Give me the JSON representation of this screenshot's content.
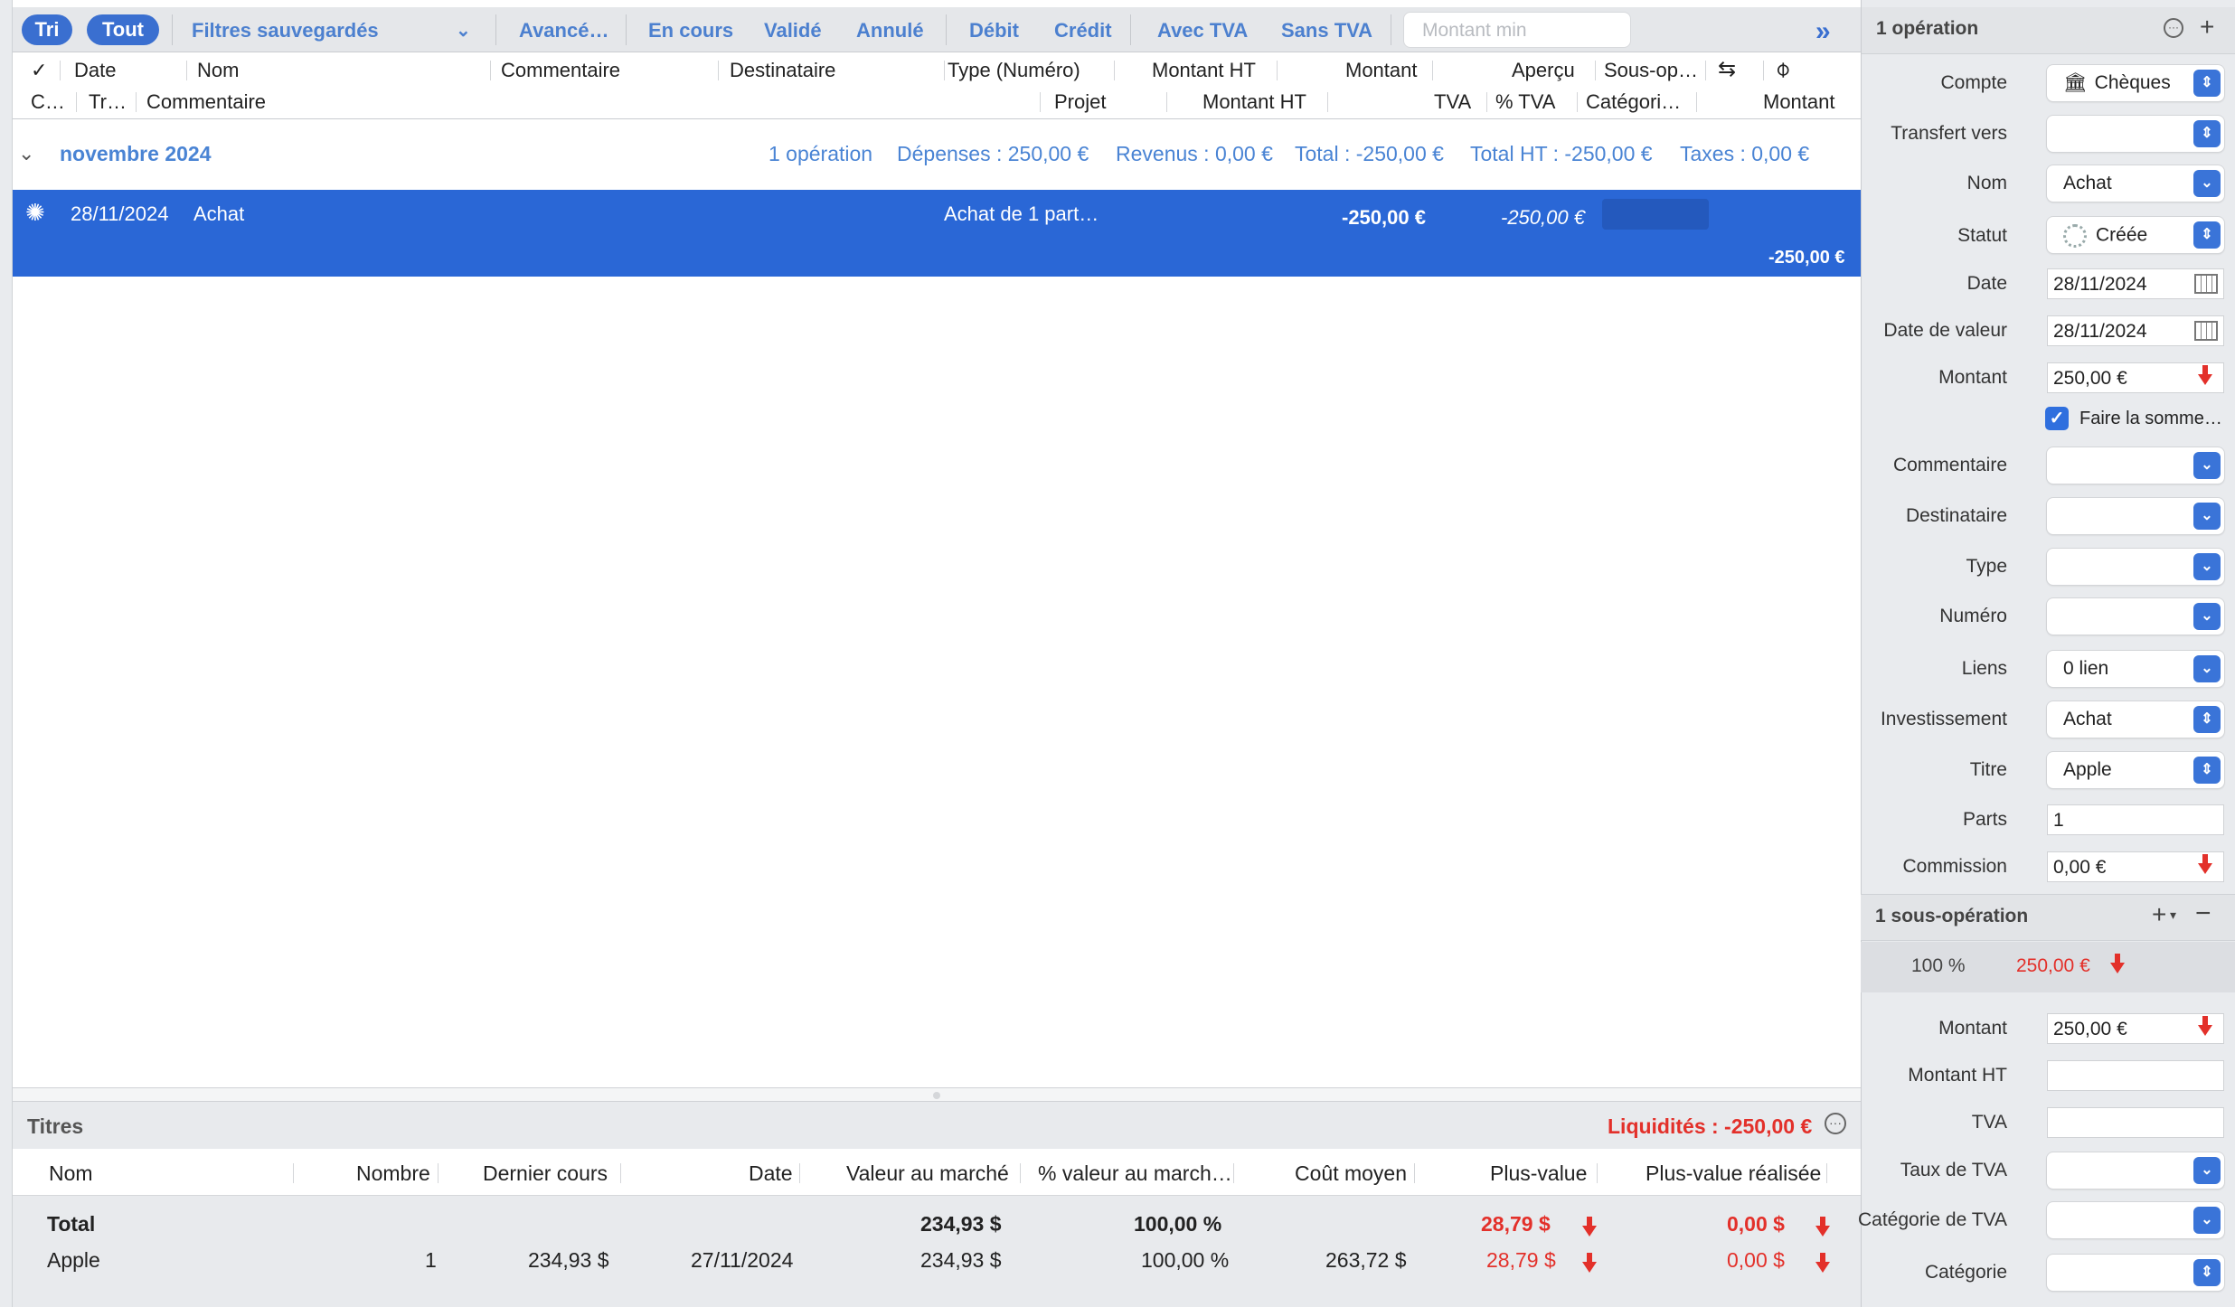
{
  "filters": {
    "sort_label": "Tri",
    "all_label": "Tout",
    "saved_filters": "Filtres sauvegardés",
    "advanced": "Avancé…",
    "in_progress": "En cours",
    "validated": "Validé",
    "cancelled": "Annulé",
    "debit": "Débit",
    "credit": "Crédit",
    "with_vat": "Avec TVA",
    "without_vat": "Sans TVA",
    "min_amount_placeholder": "Montant min"
  },
  "columns": {
    "row1": [
      "✓",
      "Date",
      "Nom",
      "Commentaire",
      "Destinataire",
      "Type (Numéro)",
      "Montant HT",
      "Montant",
      "Aperçu",
      "Sous-op…"
    ],
    "row2": [
      "C…",
      "Tr…",
      "Commentaire",
      "Projet",
      "Montant HT",
      "TVA",
      "% TVA",
      "Catégori…",
      "Montant"
    ]
  },
  "group": {
    "month": "novembre 2024",
    "count": "1 opération",
    "expenses": "Dépenses : 250,00 €",
    "income": "Revenus : 0,00 €",
    "total": "Total : -250,00 €",
    "total_ht": "Total HT : -250,00 €",
    "taxes": "Taxes : 0,00 €"
  },
  "transaction": {
    "date": "28/11/2024",
    "name": "Achat",
    "type": "Achat de 1 part…",
    "amount_ht": "-250,00 €",
    "amount": "-250,00 €",
    "sub_amount": "-250,00 €"
  },
  "securities": {
    "title": "Titres",
    "liquidity": "Liquidités : -250,00 €",
    "headers": [
      "Nom",
      "Nombre",
      "Dernier cours",
      "Date",
      "Valeur au marché",
      "% valeur au march…",
      "Coût moyen",
      "Plus-value",
      "Plus-value réalisée"
    ],
    "total": {
      "name": "Total",
      "market_value": "234,93 $",
      "pct": "100,00 %",
      "gain": "28,79 $",
      "realized": "0,00 $"
    },
    "rows": [
      {
        "name": "Apple",
        "quantity": "1",
        "last_price": "234,93 $",
        "date": "27/11/2024",
        "market_value": "234,93 $",
        "pct": "100,00 %",
        "avg_cost": "263,72 $",
        "gain": "28,79 $",
        "realized": "0,00 $"
      }
    ]
  },
  "inspector": {
    "header": "1 opération",
    "account_label": "Compte",
    "account": "Chèques",
    "transfer_label": "Transfert vers",
    "name_label": "Nom",
    "name": "Achat",
    "status_label": "Statut",
    "status": "Créée",
    "date_label": "Date",
    "date": "28/11/2024",
    "value_date_label": "Date de valeur",
    "value_date": "28/11/2024",
    "amount_label": "Montant",
    "amount": "250,00 €",
    "sum_label": "Faire la somme…",
    "comment_label": "Commentaire",
    "recipient_label": "Destinataire",
    "type_label": "Type",
    "number_label": "Numéro",
    "links_label": "Liens",
    "links": "0 lien",
    "investment_label": "Investissement",
    "investment": "Achat",
    "security_label": "Titre",
    "security": "Apple",
    "shares_label": "Parts",
    "shares": "1",
    "commission_label": "Commission",
    "commission": "0,00 €",
    "sub_header": "1 sous-opération",
    "sub_pct": "100 %",
    "sub_amount": "250,00 €",
    "sub_amount_label": "Montant",
    "sub_amount_value": "250,00 €",
    "sub_ht_label": "Montant HT",
    "sub_vat_label": "TVA",
    "sub_vat_rate_label": "Taux de TVA",
    "sub_vat_cat_label": "Catégorie de TVA",
    "sub_category_label": "Catégorie"
  }
}
